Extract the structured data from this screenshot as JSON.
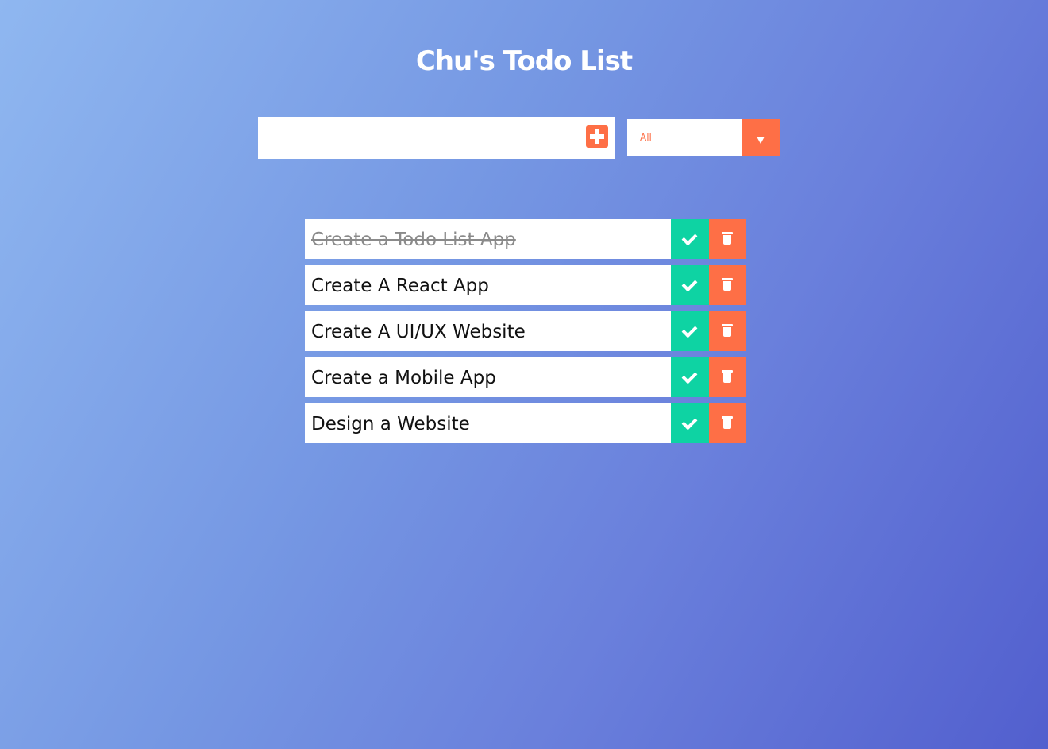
{
  "app": {
    "title": "Chu's Todo List"
  },
  "add_form": {
    "input_value": "",
    "input_placeholder": ""
  },
  "filter": {
    "selected": "All"
  },
  "colors": {
    "accent": "#fe6f46",
    "complete": "#0ed3a3",
    "text": "#111111",
    "completed_text": "#8a8a8a"
  },
  "icons": {
    "add": "plus-square-icon",
    "dropdown": "caret-down-icon",
    "complete": "check-icon",
    "delete": "trash-icon"
  },
  "todos": [
    {
      "text": "Create a Todo List App",
      "completed": true
    },
    {
      "text": "Create A React App",
      "completed": false
    },
    {
      "text": "Create A UI/UX Website",
      "completed": false
    },
    {
      "text": "Create a Mobile App",
      "completed": false
    },
    {
      "text": "Design a Website",
      "completed": false
    }
  ]
}
